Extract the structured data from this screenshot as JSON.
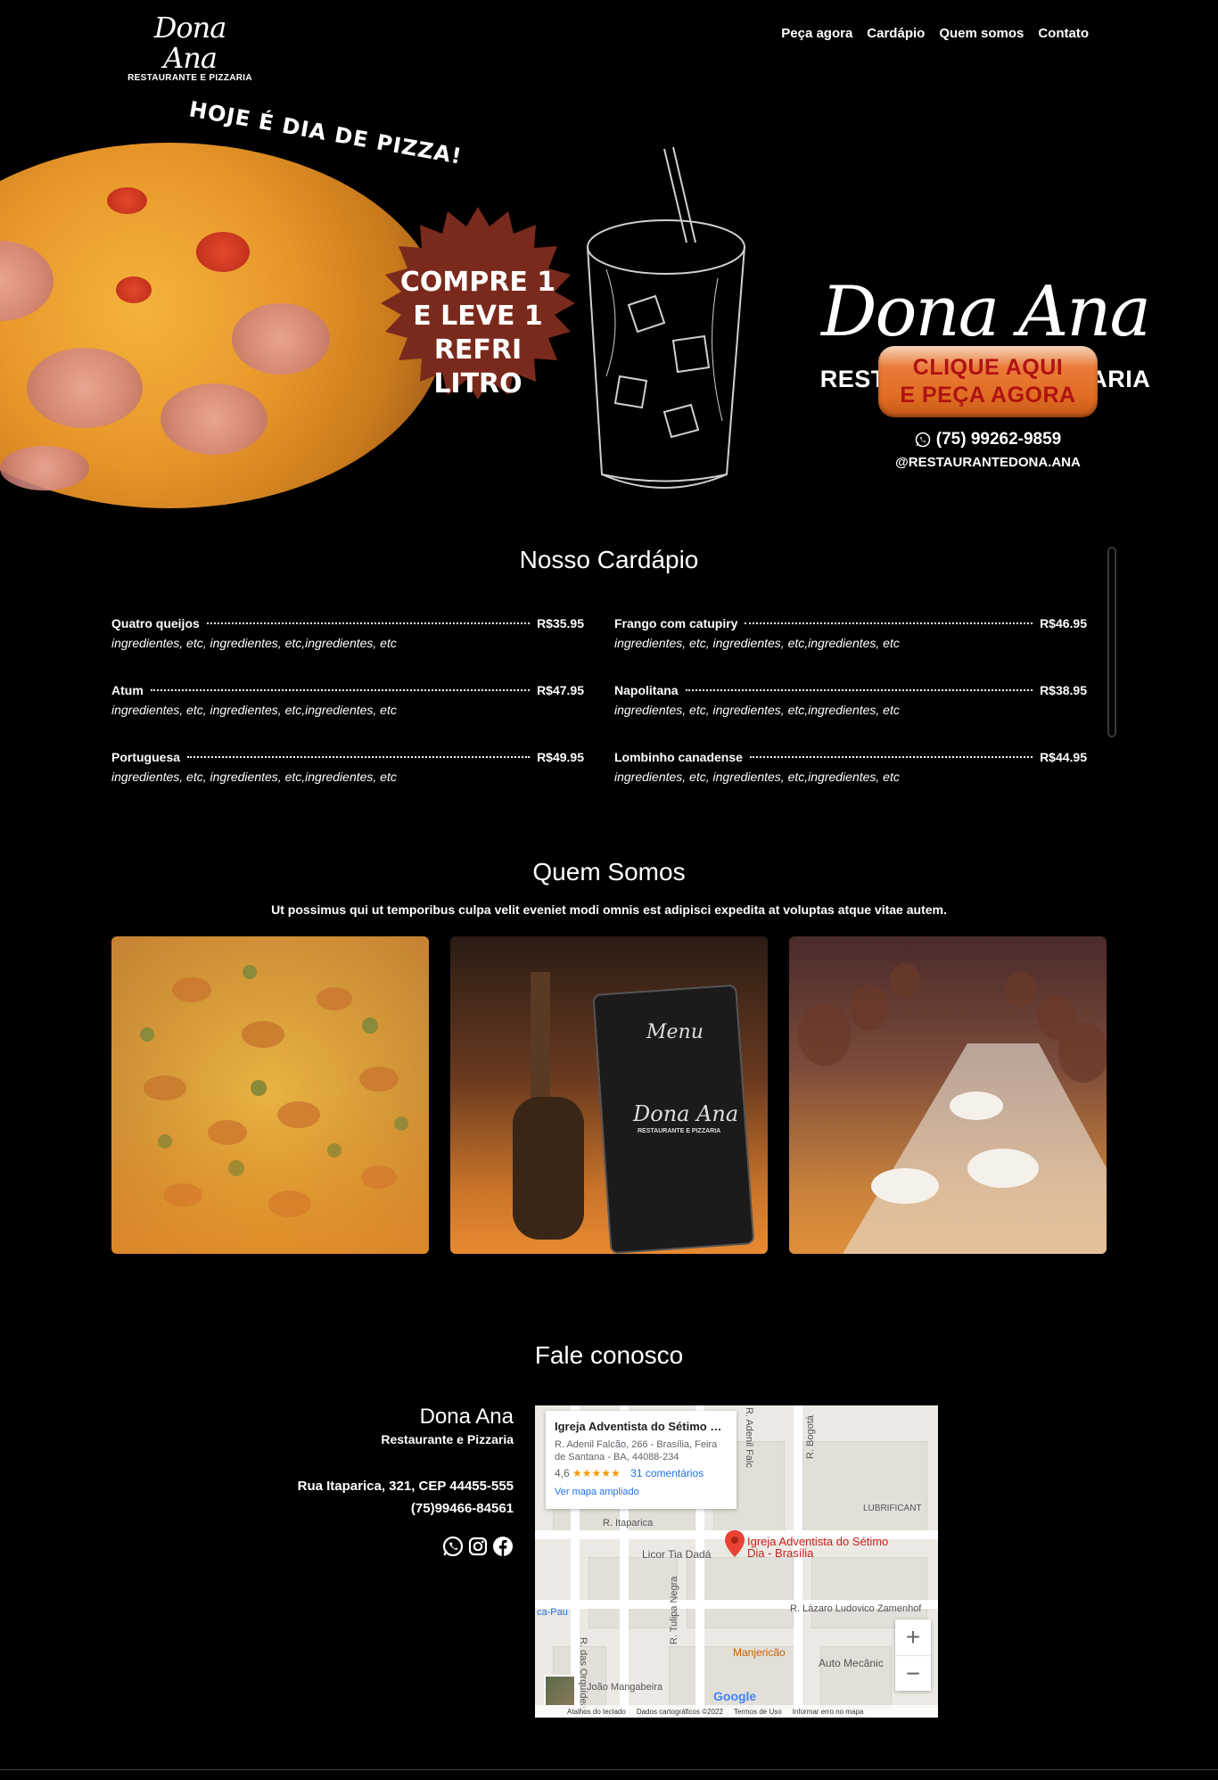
{
  "nav": {
    "logo_script": "Dona Ana",
    "logo_sub": "RESTAURANTE E PIZZARIA",
    "links": [
      "Peça agora",
      "Cardápio",
      "Quem somos",
      "Contato"
    ]
  },
  "hero": {
    "banner": "HOJE É DIA DE PIZZA!",
    "promo_line1": "COMPRE 1",
    "promo_line2": "E LEVE 1 REFRI",
    "promo_line3": "LITRO",
    "brand_script": "Dona Ana",
    "brand_sub": "RESTAURANTE E PIZZARIA",
    "cta_line1": "CLIQUE AQUI",
    "cta_line2": "E PEÇA AGORA",
    "phone": "(75) 99262-9859",
    "instagram": "@RESTAURANTEDONA.ANA",
    "accent_color": "#e06d22",
    "promo_color": "#7a2a1c"
  },
  "menu": {
    "title": "Nosso Cardápio",
    "items": [
      {
        "name": "Quatro queijos",
        "price": "R$35.95",
        "desc": "ingredientes, etc, ingredientes, etc,ingredientes, etc"
      },
      {
        "name": "Frango com catupiry",
        "price": "R$46.95",
        "desc": "ingredientes, etc, ingredientes, etc,ingredientes, etc"
      },
      {
        "name": "Atum",
        "price": "R$47.95",
        "desc": "ingredientes, etc, ingredientes, etc,ingredientes, etc"
      },
      {
        "name": "Napolitana",
        "price": "R$38.95",
        "desc": "ingredientes, etc, ingredientes, etc,ingredientes, etc"
      },
      {
        "name": "Portuguesa",
        "price": "R$49.95",
        "desc": "ingredientes, etc, ingredientes, etc,ingredientes, etc"
      },
      {
        "name": "Lombinho canadense",
        "price": "R$44.95",
        "desc": "ingredientes, etc, ingredientes, etc,ingredientes, etc"
      }
    ]
  },
  "about": {
    "title": "Quem Somos",
    "subtitle": "Ut possimus qui ut temporibus culpa velit eveniet modi omnis est adipisci expedita at voluptas atque vitae autem.",
    "photo2_menu_text": "Menu",
    "photo2_logo": "Dona Ana",
    "photo2_logo_sub": "RESTAURANTE E PIZZARIA"
  },
  "contact": {
    "title": "Fale conosco",
    "name": "Dona Ana",
    "sub": "Restaurante e Pizzaria",
    "address": "Rua Itaparica, 321, CEP 44455-555",
    "tel": "(75)99466-84561"
  },
  "map": {
    "place": "Igreja Adventista do Sétimo Di...",
    "address": "R. Adenil Falcão, 266 - Brasília, Feira de Santana - BA, 44088-234",
    "rating": "4,6",
    "stars": "★★★★★",
    "reviews": "31 comentários",
    "view_larger": "Ver mapa ampliado",
    "pin_label": "Igreja Adventista do Sétimo Dia - Brasília",
    "labels": [
      "R. Itaparica",
      "Licor Tia Dadá",
      "Manjericão",
      "R. Lázaro Ludovico Zamenhof",
      "R. das Orquídeas",
      "R. Tulipa Negra",
      "João Mangabeira",
      "Auto Mecânic",
      "R. Bogotá",
      "R. Adenil Falc",
      "ca-Pau",
      "LUBRIFICANT"
    ],
    "footer": [
      "Atalhos do teclado",
      "Dados cartográficos ©2022",
      "Termos de Uso",
      "Informar erro no mapa"
    ],
    "google": "Google",
    "zoom_in": "+",
    "zoom_out": "−"
  }
}
